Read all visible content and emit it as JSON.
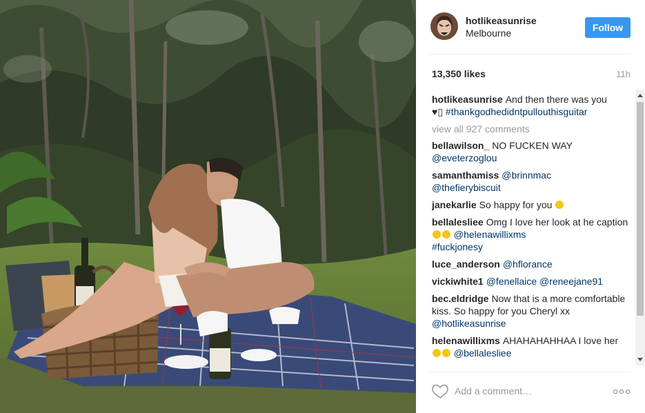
{
  "post": {
    "image_alt": "Couple kissing on a picnic blanket"
  },
  "header": {
    "username": "hotlikeasunrise",
    "location": "Melbourne",
    "follow_label": "Follow"
  },
  "stats": {
    "likes": "13,350 likes",
    "time": "11h"
  },
  "caption": {
    "user": "hotlikeasunrise",
    "text": "And then there was you",
    "line2_symbol": "♥▯",
    "hashtag": "#thankgodhedidntpullouthisguitar"
  },
  "view_all": "view all 927 comments",
  "comments": [
    {
      "user": "bellawilson_",
      "text": "NO FUCKEN WAY",
      "link": "@eveterzoglou"
    },
    {
      "user": "samanthamiss",
      "link": "@brinnmac",
      "link2": "@thefierybiscuit"
    },
    {
      "user": "janekarlie",
      "text": "So happy for you"
    },
    {
      "user": "bellalesliee",
      "text": "Omg I love her look at he caption",
      "link": "@helenawillixms",
      "link2": "#fuckjonesy"
    },
    {
      "user": "luce_anderson",
      "link": "@hflorance"
    },
    {
      "user": "vickiwhite1",
      "link": "@fenellaice",
      "link2": "@reneejane91"
    },
    {
      "user": "bec.eldridge",
      "text": "Now that is a more comfortable kiss. So happy for you Cheryl xx",
      "link": "@hotlikeasunrise"
    },
    {
      "user": "helenawillixms",
      "text": "AHAHAHAHHAA I love her",
      "link": "@bellalesliee"
    }
  ],
  "footer": {
    "placeholder": "Add a comment…"
  },
  "colors": {
    "accent": "#3897f0",
    "link": "#003569",
    "muted": "#999999"
  },
  "icons": {
    "like": "heart-outline-icon",
    "more": "more-options-icon"
  }
}
